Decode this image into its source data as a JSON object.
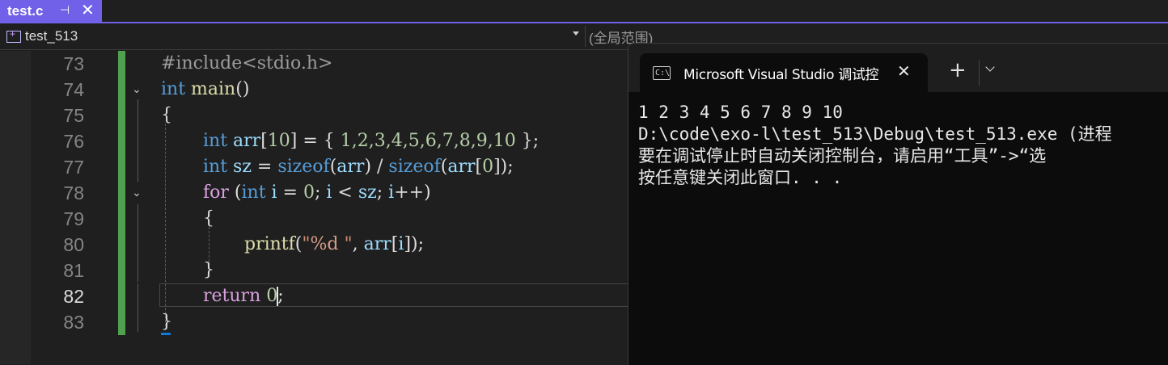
{
  "tab": {
    "title": "test.c",
    "pin_glyph": "⊣",
    "close_glyph": "✕"
  },
  "nav": {
    "project": "test_513",
    "scope": "(全局范围)"
  },
  "editor": {
    "line_numbers": [
      "73",
      "74",
      "75",
      "76",
      "77",
      "78",
      "79",
      "80",
      "81",
      "82",
      "83"
    ],
    "current_line": "82",
    "fold_glyph": "⌄"
  },
  "code": {
    "l73": {
      "a": "#include",
      "b": "<stdio.h>"
    },
    "l74": {
      "kw": "int",
      "fn": "main",
      "rest": "()"
    },
    "l75": {
      "text": "{"
    },
    "l76": {
      "kw": "int",
      "var": "arr",
      "b1": "[",
      "n10": "10",
      "b2": "] = { ",
      "nums": "1,2,3,4,5,6,7,8,9,10",
      "end": " };"
    },
    "l77": {
      "kw": "int",
      "var": "sz",
      "eq": " = ",
      "fn1": "sizeof",
      "p1": "(",
      "v1": "arr",
      "p2": ") / ",
      "fn2": "sizeof",
      "p3": "(",
      "v2": "arr",
      "p4": "[",
      "n0": "0",
      "p5": "]);"
    },
    "l78": {
      "kw": "for",
      "p1": " (",
      "kw2": "int",
      "v1": " i",
      "eq": " = ",
      "n0": "0",
      "semi": "; ",
      "v2": "i",
      "lt": " < ",
      "v3": "sz",
      "semi2": "; ",
      "v4": "i",
      "pp": "++)"
    },
    "l79": {
      "text": "{"
    },
    "l80": {
      "fn": "printf",
      "p1": "(",
      "s1": "\"",
      "ph": "%d",
      "s2": " \"",
      "comma": ", ",
      "v1": "arr",
      "b1": "[",
      "v2": "i",
      "b2": "]);"
    },
    "l81": {
      "text": "}"
    },
    "l82": {
      "kw": "return",
      "sp": " ",
      "n0": "0",
      "semi": ";"
    },
    "l83": {
      "text": "}"
    }
  },
  "terminal": {
    "title": "Microsoft Visual Studio 调试控",
    "icon_text": "C:\\",
    "close_glyph": "✕",
    "plus_glyph": "+",
    "lines": [
      "1 2 3 4 5 6 7 8 9 10",
      "D:\\code\\exo-l\\test_513\\Debug\\test_513.exe (进程",
      "要在调试停止时自动关闭控制台，请启用“工具”->“选",
      "按任意键关闭此窗口. . ."
    ]
  }
}
